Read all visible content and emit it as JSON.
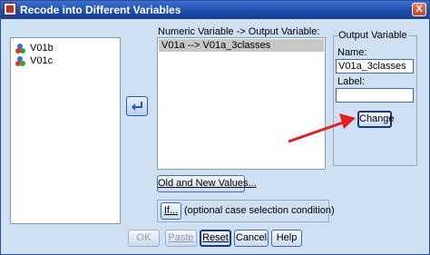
{
  "window": {
    "title": "Recode into Different Variables",
    "close_glyph": "X"
  },
  "source_vars": [
    {
      "name": "V01b",
      "icon": "nominal-variable-icon"
    },
    {
      "name": "V01c",
      "icon": "nominal-variable-icon"
    }
  ],
  "mapping": {
    "label": "Numeric Variable -> Output Variable:",
    "rows": [
      "V01a --> V01a_3classes"
    ]
  },
  "output": {
    "group_label": "Output Variable",
    "name_label": "Name:",
    "name_value": "V01a_3classes",
    "label_label": "Label:",
    "label_value": "",
    "change_button": "Change"
  },
  "old_new_button": "Old and New Values...",
  "if_button": "If...",
  "if_text": "(optional case selection condition)",
  "footer": {
    "ok": "OK",
    "paste": "Paste",
    "reset": "Reset",
    "cancel": "Cancel",
    "help": "Help"
  },
  "colors": {
    "titlebar": "#1e4ba8",
    "dialog_bg": "#cfe0f3",
    "annotation_arrow": "#e02020"
  }
}
